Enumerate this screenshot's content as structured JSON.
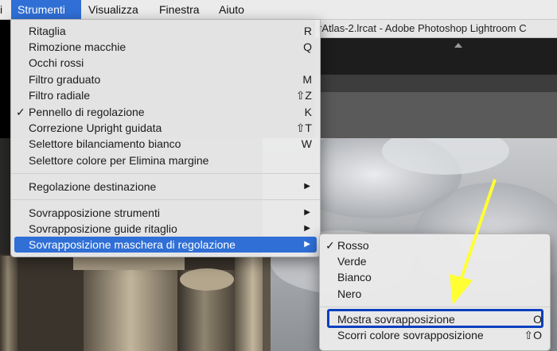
{
  "menubar": {
    "items": [
      {
        "label": "i",
        "active": false
      },
      {
        "label": "Strumenti",
        "active": true
      },
      {
        "label": "Visualizza",
        "active": false
      },
      {
        "label": "Finestra",
        "active": false
      },
      {
        "label": "Aiuto",
        "active": false
      }
    ]
  },
  "window": {
    "title": "rAtlas-2.lrcat - Adobe Photoshop Lightroom C"
  },
  "strumenti_menu": {
    "items": [
      {
        "label": "Ritaglia",
        "shortcut": "R"
      },
      {
        "label": "Rimozione macchie",
        "shortcut": "Q"
      },
      {
        "label": "Occhi rossi",
        "shortcut": ""
      },
      {
        "label": "Filtro graduato",
        "shortcut": "M"
      },
      {
        "label": "Filtro radiale",
        "shortcut": "⇧Z"
      },
      {
        "label": "Pennello di regolazione",
        "shortcut": "K",
        "checked": true
      },
      {
        "label": "Correzione Upright guidata",
        "shortcut": "⇧T"
      },
      {
        "label": "Selettore bilanciamento bianco",
        "shortcut": "W"
      },
      {
        "label": "Selettore colore per Elimina margine",
        "shortcut": ""
      },
      {
        "label": "Regolazione destinazione",
        "submenu": true
      },
      {
        "label": "Sovrapposizione strumenti",
        "submenu": true
      },
      {
        "label": "Sovrapposizione guide ritaglio",
        "submenu": true
      },
      {
        "label": "Sovrapposizione maschera di regolazione",
        "submenu": true,
        "highlighted": true
      }
    ],
    "check_glyph": "✓",
    "arrow_glyph": "▶"
  },
  "overlay_submenu": {
    "items": [
      {
        "label": "Rosso",
        "checked": true
      },
      {
        "label": "Verde"
      },
      {
        "label": "Bianco"
      },
      {
        "label": "Nero"
      },
      {
        "label": "Mostra sovrapposizione",
        "shortcut": "O"
      },
      {
        "label": "Scorri colore sovrapposizione",
        "shortcut": "⇧O"
      }
    ]
  },
  "colors": {
    "menu_highlight": "#2f6fd6",
    "focus_box": "#0a3fbf",
    "annotation_arrow": "#ffff33"
  }
}
